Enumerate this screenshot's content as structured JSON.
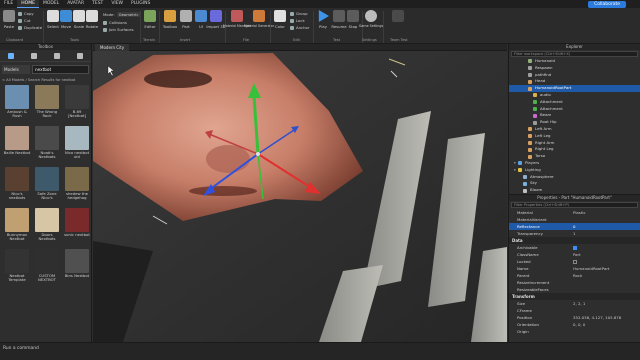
{
  "menu": {
    "items": [
      "FILE",
      "HOME",
      "MODEL",
      "AVATAR",
      "TEST",
      "VIEW",
      "PLUGINS"
    ],
    "active_index": 1,
    "collaborate_label": "Collaborate"
  },
  "ribbon": {
    "clipboard": {
      "paste": "Paste",
      "copy": "Copy",
      "cut": "Cut",
      "duplicate": "Duplicate",
      "group_label": "Clipboard"
    },
    "tools": {
      "select": "Select",
      "move": "Move",
      "scale": "Scale",
      "rotate": "Rotate",
      "group_label": "Tools"
    },
    "mode": {
      "mode_label": "Mode:",
      "mode_value": "Geometric",
      "collisions": "Collisions",
      "join_surfaces": "Join Surfaces"
    },
    "terrain": {
      "editor": "Editor",
      "group_label": "Terrain"
    },
    "insert": {
      "toolbox": "Toolbox",
      "part": "Part",
      "ui": "UI",
      "import3d": "Import 3D",
      "group_label": "Insert"
    },
    "file": {
      "material_manager": "Material Manager",
      "material_generator": "Material Generator",
      "group_label": "File"
    },
    "edit": {
      "color": "Color",
      "group": "Group",
      "lock": "Lock",
      "anchor": "Anchor",
      "group_label": "Edit"
    },
    "test": {
      "play": "Play",
      "resume": "Resume",
      "stop": "Stop",
      "group_label": "Test"
    },
    "settings": {
      "game_settings": "Game Settings",
      "group_label": "Settings"
    },
    "team_test": {
      "group_label": "Team Test"
    }
  },
  "toolbox": {
    "title": "Toolbox",
    "category": "Models",
    "query": "nextbot",
    "breadcrumb": "< All Models / Search Results for nextbot",
    "items": [
      {
        "label": "Ambush & Rush",
        "color": "#6a8fb0"
      },
      {
        "label": "The Wrong Rock",
        "color": "#8a7a5a"
      },
      {
        "label": "B-69 [Nextbot]",
        "color": "#3a3a3a"
      },
      {
        "label": "Bailie Nextbot",
        "color": "#b89a88"
      },
      {
        "label": "Noob's Nextbots",
        "color": "#4a4a4a"
      },
      {
        "label": "Nico nextbot old",
        "color": "#a8b8c0"
      },
      {
        "label": "Nico's nextbots",
        "color": "#5a4030"
      },
      {
        "label": "Safe Zone Nico's",
        "color": "#3e5a6a"
      },
      {
        "label": "shedew the hedgehog",
        "color": "#7a6a4a"
      },
      {
        "label": "Bunnymov Nextbot",
        "color": "#c0a070"
      },
      {
        "label": "Doors Nextbots",
        "color": "#d6c6a6"
      },
      {
        "label": "sonic nextbot",
        "color": "#7a2a2a"
      },
      {
        "label": "Nextbot Template",
        "color": "#333333"
      },
      {
        "label": "CUSTOM NEXTBOT",
        "color": "#2f2f2f"
      },
      {
        "label": "Bins Nextbot",
        "color": "#505050"
      }
    ]
  },
  "viewport": {
    "tab_name": "Modern City"
  },
  "explorer": {
    "title": "Explorer",
    "filter_placeholder": "Filter workspace (Ctrl+Shift+X)",
    "rows": [
      {
        "label": "Humanoid",
        "indent": 3,
        "icon": "#8fb07a",
        "selected": false
      },
      {
        "label": "Respawn",
        "indent": 3,
        "icon": "#a0a0a0",
        "selected": false
      },
      {
        "label": "pathfind",
        "indent": 3,
        "icon": "#a0a0a0",
        "selected": false
      },
      {
        "label": "Head",
        "indent": 3,
        "icon": "#d8a060",
        "selected": false
      },
      {
        "label": "HumanoidRootPart",
        "indent": 3,
        "icon": "#d8a060",
        "selected": true
      },
      {
        "label": "audio",
        "indent": 4,
        "icon": "#d6b24a",
        "selected": false
      },
      {
        "label": "Attachment",
        "indent": 4,
        "icon": "#4fb04f",
        "selected": false
      },
      {
        "label": "Attachment",
        "indent": 4,
        "icon": "#4fb04f",
        "selected": false
      },
      {
        "label": "Beam",
        "indent": 4,
        "icon": "#c86ad0",
        "selected": false
      },
      {
        "label": "Root Hip",
        "indent": 4,
        "icon": "#9a9a9a",
        "selected": false
      },
      {
        "label": "Left Arm",
        "indent": 3,
        "icon": "#d8a060",
        "selected": false
      },
      {
        "label": "Left Leg",
        "indent": 3,
        "icon": "#d8a060",
        "selected": false
      },
      {
        "label": "Right Arm",
        "indent": 3,
        "icon": "#d8a060",
        "selected": false
      },
      {
        "label": "Right Leg",
        "indent": 3,
        "icon": "#d8a060",
        "selected": false
      },
      {
        "label": "Torso",
        "indent": 3,
        "icon": "#d8a060",
        "selected": false
      },
      {
        "label": "Players",
        "indent": 1,
        "icon": "#5fa0e0",
        "selected": false
      },
      {
        "label": "Lighting",
        "indent": 1,
        "icon": "#e0c040",
        "selected": false
      },
      {
        "label": "Atmosphere",
        "indent": 2,
        "icon": "#8fb0d0",
        "selected": false
      },
      {
        "label": "Sky",
        "indent": 2,
        "icon": "#7ab0e0",
        "selected": false
      },
      {
        "label": "Bloom",
        "indent": 2,
        "icon": "#c0c0c0",
        "selected": false
      },
      {
        "label": "ColorCorrection",
        "indent": 2,
        "icon": "#d080c0",
        "selected": false
      }
    ]
  },
  "properties": {
    "title": "Properties - Part \"HumanoidRootPart\"",
    "filter_placeholder": "Filter Properties (Ctrl+Shift+P)",
    "rows_top": [
      {
        "name": "Material",
        "value": "Plastic",
        "hl": false
      },
      {
        "name": "MaterialVariant",
        "value": "",
        "hl": false
      },
      {
        "name": "Reflectance",
        "value": "0",
        "hl": true
      },
      {
        "name": "Transparency",
        "value": "1",
        "hl": false
      }
    ],
    "data_label": "Data",
    "rows_data": [
      {
        "name": "Archivable",
        "value": "",
        "check": true
      },
      {
        "name": "ClassName",
        "value": "Part",
        "check": null
      },
      {
        "name": "Locked",
        "value": "",
        "check": false
      },
      {
        "name": "Name",
        "value": "HumanoidRootPart",
        "check": null
      },
      {
        "name": "Parent",
        "value": "Rock",
        "check": null
      },
      {
        "name": "ResizeIncrement",
        "value": "",
        "check": null
      },
      {
        "name": "ResizeableFaces",
        "value": "",
        "check": null
      }
    ],
    "transform_label": "Transform",
    "rows_transform": [
      {
        "name": "Size",
        "value": "2, 2, 1"
      },
      {
        "name": "CFrame",
        "value": ""
      },
      {
        "name": "Position",
        "value": "352.038, 4.127, 105.876"
      },
      {
        "name": "Orientation",
        "value": "0, 0, 0"
      },
      {
        "name": "Origin",
        "value": ""
      }
    ]
  },
  "command_bar": {
    "placeholder": "Run a command"
  }
}
